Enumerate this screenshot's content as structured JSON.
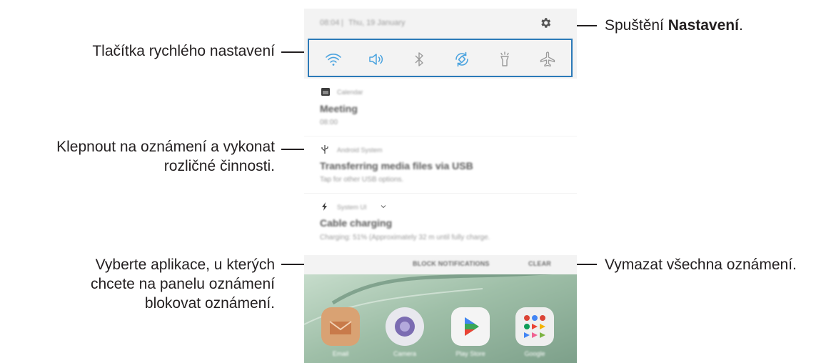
{
  "annotations": {
    "quick_settings": "Tlačítka rychlého nastavení",
    "settings_prefix": "Spuštění ",
    "settings_bold": "Nastavení",
    "settings_suffix": ".",
    "notification_line1": "Klepnout na oznámení a vykonat",
    "notification_line2": "rozličné činnosti.",
    "block_line1": "Vyberte aplikace, u kterých",
    "block_line2": "chcete na panelu oznámení",
    "block_line3": "blokovat oznámení.",
    "clear": "Vymazat všechna oznámení."
  },
  "status_bar": {
    "time": "08:04",
    "date": "Thu, 19 January"
  },
  "quick_settings": [
    {
      "icon": "wifi-icon"
    },
    {
      "icon": "sound-icon"
    },
    {
      "icon": "bluetooth-icon"
    },
    {
      "icon": "auto-rotate-icon"
    },
    {
      "icon": "flashlight-icon"
    },
    {
      "icon": "airplane-mode-icon"
    }
  ],
  "notifications": [
    {
      "app": "Calendar",
      "title": "Meeting",
      "body": "08:00"
    },
    {
      "app": "Android System",
      "title": "Transferring media files via USB",
      "body": "Tap for other USB options."
    },
    {
      "app": "System UI",
      "title": "Cable charging",
      "body": "Charging: 51% (Approximately 32 m until fully charge."
    }
  ],
  "actions": {
    "block": "BLOCK NOTIFICATIONS",
    "clear": "CLEAR"
  },
  "home_apps": [
    {
      "label": "Email"
    },
    {
      "label": "Camera"
    },
    {
      "label": "Play Store"
    },
    {
      "label": "Google"
    }
  ],
  "colors": {
    "highlight_border": "#2c7ab8",
    "panel_bg": "#f3f3f3"
  }
}
